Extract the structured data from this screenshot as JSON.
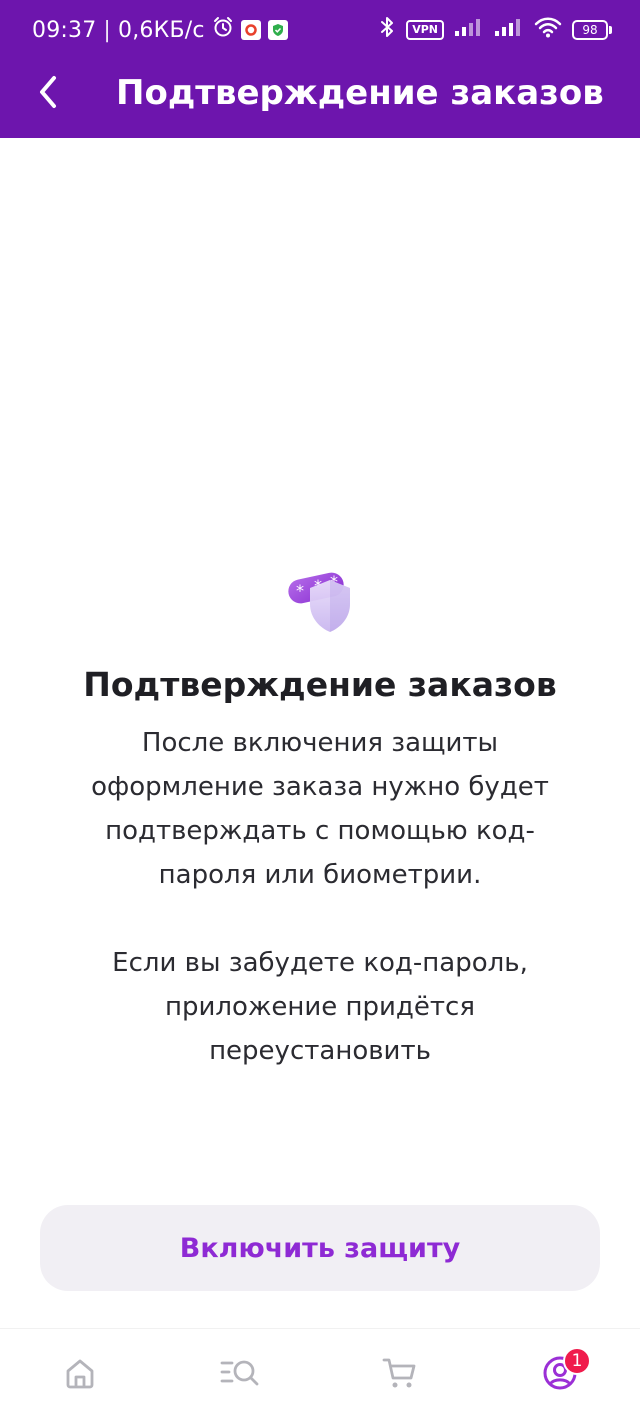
{
  "status_bar": {
    "time": "09:37",
    "separator": "|",
    "speed": "0,6КБ/с",
    "vpn_label": "VPN",
    "battery_level": "98"
  },
  "app_bar": {
    "title": "Подтверждение заказов",
    "back_icon": "chevron-left-icon"
  },
  "main": {
    "illustration_icon": "shield-password-icon",
    "title": "Подтверждение заказов",
    "paragraph1": "После включения защиты оформление заказа нужно будет подтверждать с помощью код-пароля или биометрии.",
    "paragraph2": "Если вы забудете код-пароль, приложение придётся переустановить"
  },
  "primary_button": {
    "label": "Включить защиту"
  },
  "bottom_nav": {
    "items": [
      {
        "icon": "home-icon"
      },
      {
        "icon": "catalog-search-icon"
      },
      {
        "icon": "cart-icon"
      },
      {
        "icon": "profile-icon"
      }
    ],
    "profile_badge": "1"
  },
  "colors": {
    "brand": "#6d15ad",
    "accent_text": "#8e2ad4",
    "button_bg": "#f1eff4",
    "badge": "#f01b4c",
    "nav_icon": "#b4b4ba"
  }
}
